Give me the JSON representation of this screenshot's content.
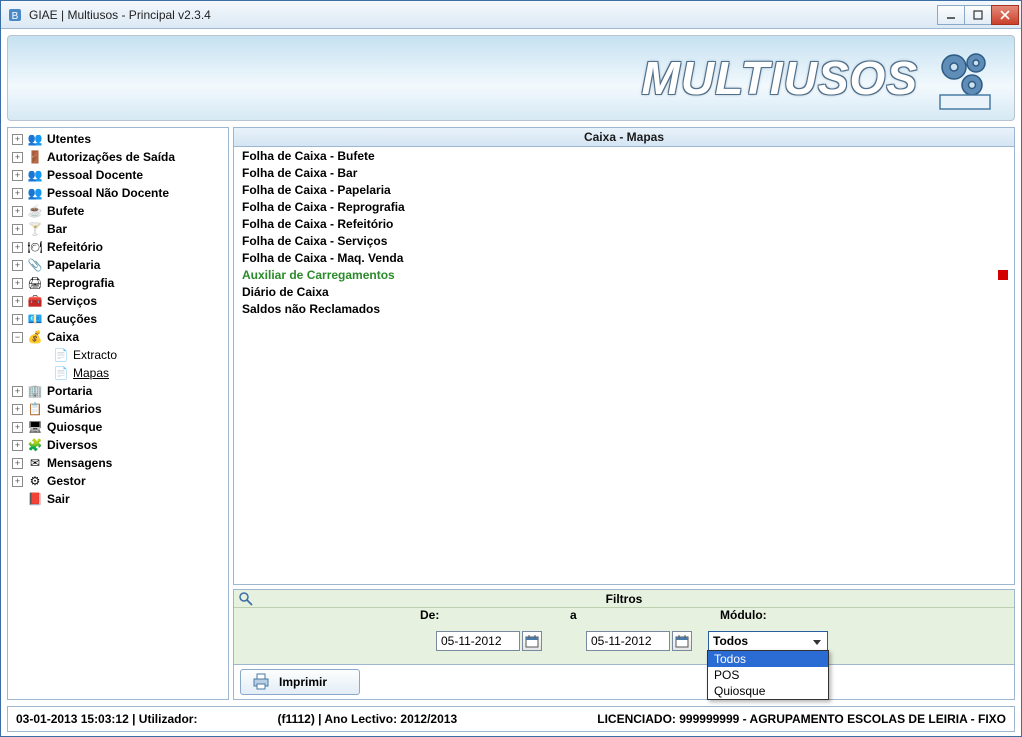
{
  "window": {
    "title": "GIAE | Multiusos - Principal v2.3.4"
  },
  "banner": {
    "logo_text": "MULTIUSOS"
  },
  "sidebar": {
    "items": [
      {
        "label": "Utentes",
        "icon": "👥",
        "state": "collapsed"
      },
      {
        "label": "Autorizações de Saída",
        "icon": "🚪",
        "state": "collapsed"
      },
      {
        "label": "Pessoal Docente",
        "icon": "👥",
        "state": "collapsed"
      },
      {
        "label": "Pessoal Não Docente",
        "icon": "👥",
        "state": "collapsed"
      },
      {
        "label": "Bufete",
        "icon": "☕",
        "state": "collapsed"
      },
      {
        "label": "Bar",
        "icon": "🍸",
        "state": "collapsed"
      },
      {
        "label": "Refeitório",
        "icon": "🍽",
        "state": "collapsed"
      },
      {
        "label": "Papelaria",
        "icon": "📎",
        "state": "collapsed"
      },
      {
        "label": "Reprografia",
        "icon": "🖨",
        "state": "collapsed"
      },
      {
        "label": "Serviços",
        "icon": "🧰",
        "state": "collapsed"
      },
      {
        "label": "Cauções",
        "icon": "💶",
        "state": "collapsed"
      },
      {
        "label": "Caixa",
        "icon": "💰",
        "state": "expanded",
        "children": [
          {
            "label": "Extracto",
            "icon": "📄",
            "selected": false
          },
          {
            "label": "Mapas",
            "icon": "📄",
            "selected": true
          }
        ]
      },
      {
        "label": "Portaria",
        "icon": "🏢",
        "state": "collapsed"
      },
      {
        "label": "Sumários",
        "icon": "📋",
        "state": "collapsed"
      },
      {
        "label": "Quiosque",
        "icon": "🖥",
        "state": "collapsed"
      },
      {
        "label": "Diversos",
        "icon": "🧩",
        "state": "collapsed"
      },
      {
        "label": "Mensagens",
        "icon": "✉",
        "state": "collapsed"
      },
      {
        "label": "Gestor",
        "icon": "⚙",
        "state": "collapsed"
      },
      {
        "label": "Sair",
        "icon": "📕",
        "state": "leaf"
      }
    ]
  },
  "list": {
    "header": "Caixa - Mapas",
    "rows": [
      {
        "label": "Folha de Caixa - Bufete",
        "active": false
      },
      {
        "label": "Folha de Caixa - Bar",
        "active": false
      },
      {
        "label": "Folha de Caixa - Papelaria",
        "active": false
      },
      {
        "label": "Folha de Caixa - Reprografia",
        "active": false
      },
      {
        "label": "Folha de Caixa - Refeitório",
        "active": false
      },
      {
        "label": "Folha de Caixa - Serviços",
        "active": false
      },
      {
        "label": "Folha de Caixa - Maq. Venda",
        "active": false
      },
      {
        "label": "Auxiliar de Carregamentos",
        "active": true,
        "flag": true
      },
      {
        "label": "Diário de Caixa",
        "active": false
      },
      {
        "label": "Saldos não Reclamados",
        "active": false
      }
    ]
  },
  "filters": {
    "title": "Filtros",
    "from_label": "De:",
    "to_label": "a",
    "module_label": "Módulo:",
    "from_value": "05-11-2012",
    "to_value": "05-11-2012",
    "combo_value": "Todos",
    "combo_options": [
      "Todos",
      "POS",
      "Quiosque"
    ],
    "combo_selected_index": 0
  },
  "print": {
    "label": "Imprimir"
  },
  "status": {
    "left": "03-01-2013 15:03:12  |  Utilizador:",
    "mid": "(f1112) | Ano Lectivo: 2012/2013",
    "right": "LICENCIADO: 999999999 - AGRUPAMENTO ESCOLAS DE LEIRIA - FIXO"
  }
}
